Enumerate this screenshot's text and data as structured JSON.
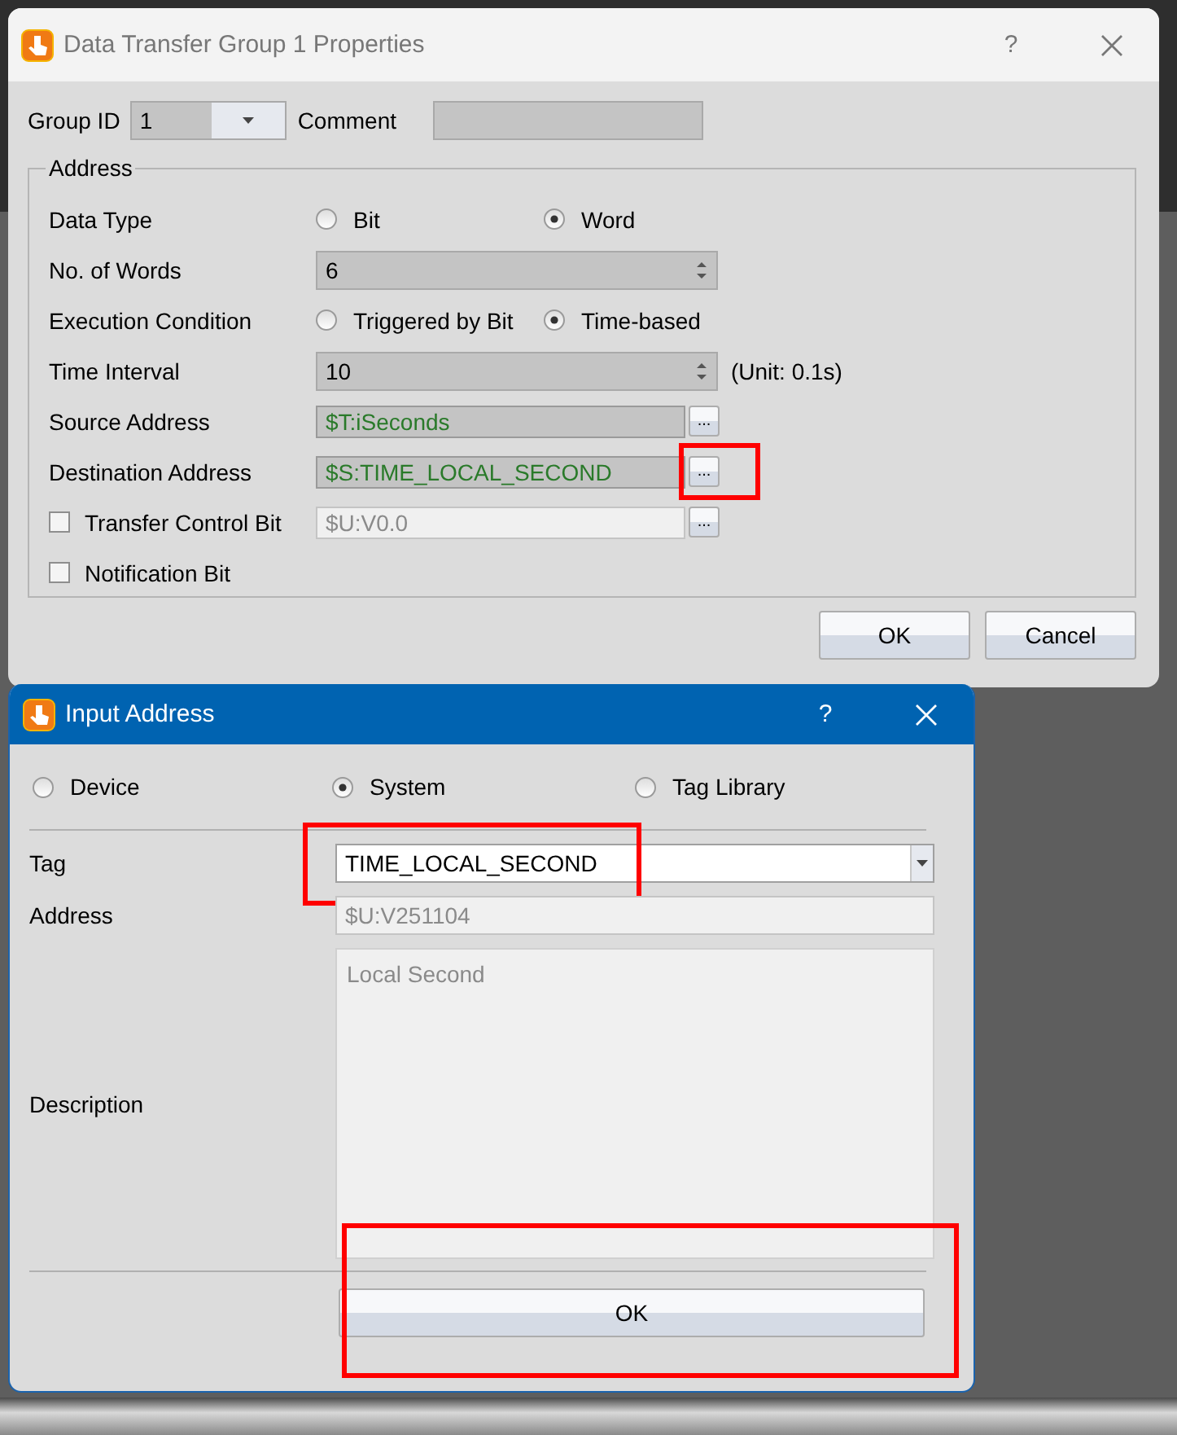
{
  "properties_dialog": {
    "title": "Data Transfer Group 1 Properties",
    "help": "?",
    "group_id": {
      "label": "Group ID",
      "value": "1"
    },
    "comment": {
      "label": "Comment"
    },
    "address_group": {
      "title": "Address",
      "rows": [
        {
          "kind": "radio",
          "label": "Data Type",
          "options": [
            {
              "label": "Bit",
              "selected": false
            },
            {
              "label": "Word",
              "selected": true
            }
          ]
        },
        {
          "kind": "spin",
          "label": "No. of Words",
          "value": "6"
        },
        {
          "kind": "radio",
          "label": "Execution Condition",
          "options": [
            {
              "label": "Triggered by Bit",
              "selected": false
            },
            {
              "label": "Time-based",
              "selected": true
            }
          ]
        },
        {
          "kind": "spin",
          "label": "Time Interval",
          "value": "10",
          "unit": "(Unit: 0.1s)"
        },
        {
          "kind": "address",
          "label": "Source Address",
          "value": "$T:iSeconds",
          "browse": "...",
          "highlighted": false
        },
        {
          "kind": "address",
          "label": "Destination Address",
          "value": "$S:TIME_LOCAL_SECOND",
          "browse": "...",
          "highlighted": true
        },
        {
          "kind": "check_address",
          "label": "Transfer Control Bit",
          "checked": false,
          "value": "$U:V0.0",
          "browse": "..."
        },
        {
          "kind": "check",
          "label": "Notification Bit",
          "checked": false
        }
      ]
    },
    "buttons": [
      {
        "label": "OK"
      },
      {
        "label": "Cancel"
      }
    ]
  },
  "input_dialog": {
    "title": "Input Address",
    "help": "?",
    "sources": [
      {
        "label": "Device",
        "selected": false
      },
      {
        "label": "System",
        "selected": true
      },
      {
        "label": "Tag Library",
        "selected": false
      }
    ],
    "fields": [
      {
        "kind": "combo",
        "label": "Tag",
        "value": "TIME_LOCAL_SECOND",
        "highlighted": true
      },
      {
        "kind": "readonly",
        "label": "Address",
        "value": "$U:V251104"
      },
      {
        "kind": "memo",
        "label": "Description",
        "value": "Local Second"
      }
    ],
    "ok": {
      "label": "OK",
      "highlighted": true
    }
  }
}
